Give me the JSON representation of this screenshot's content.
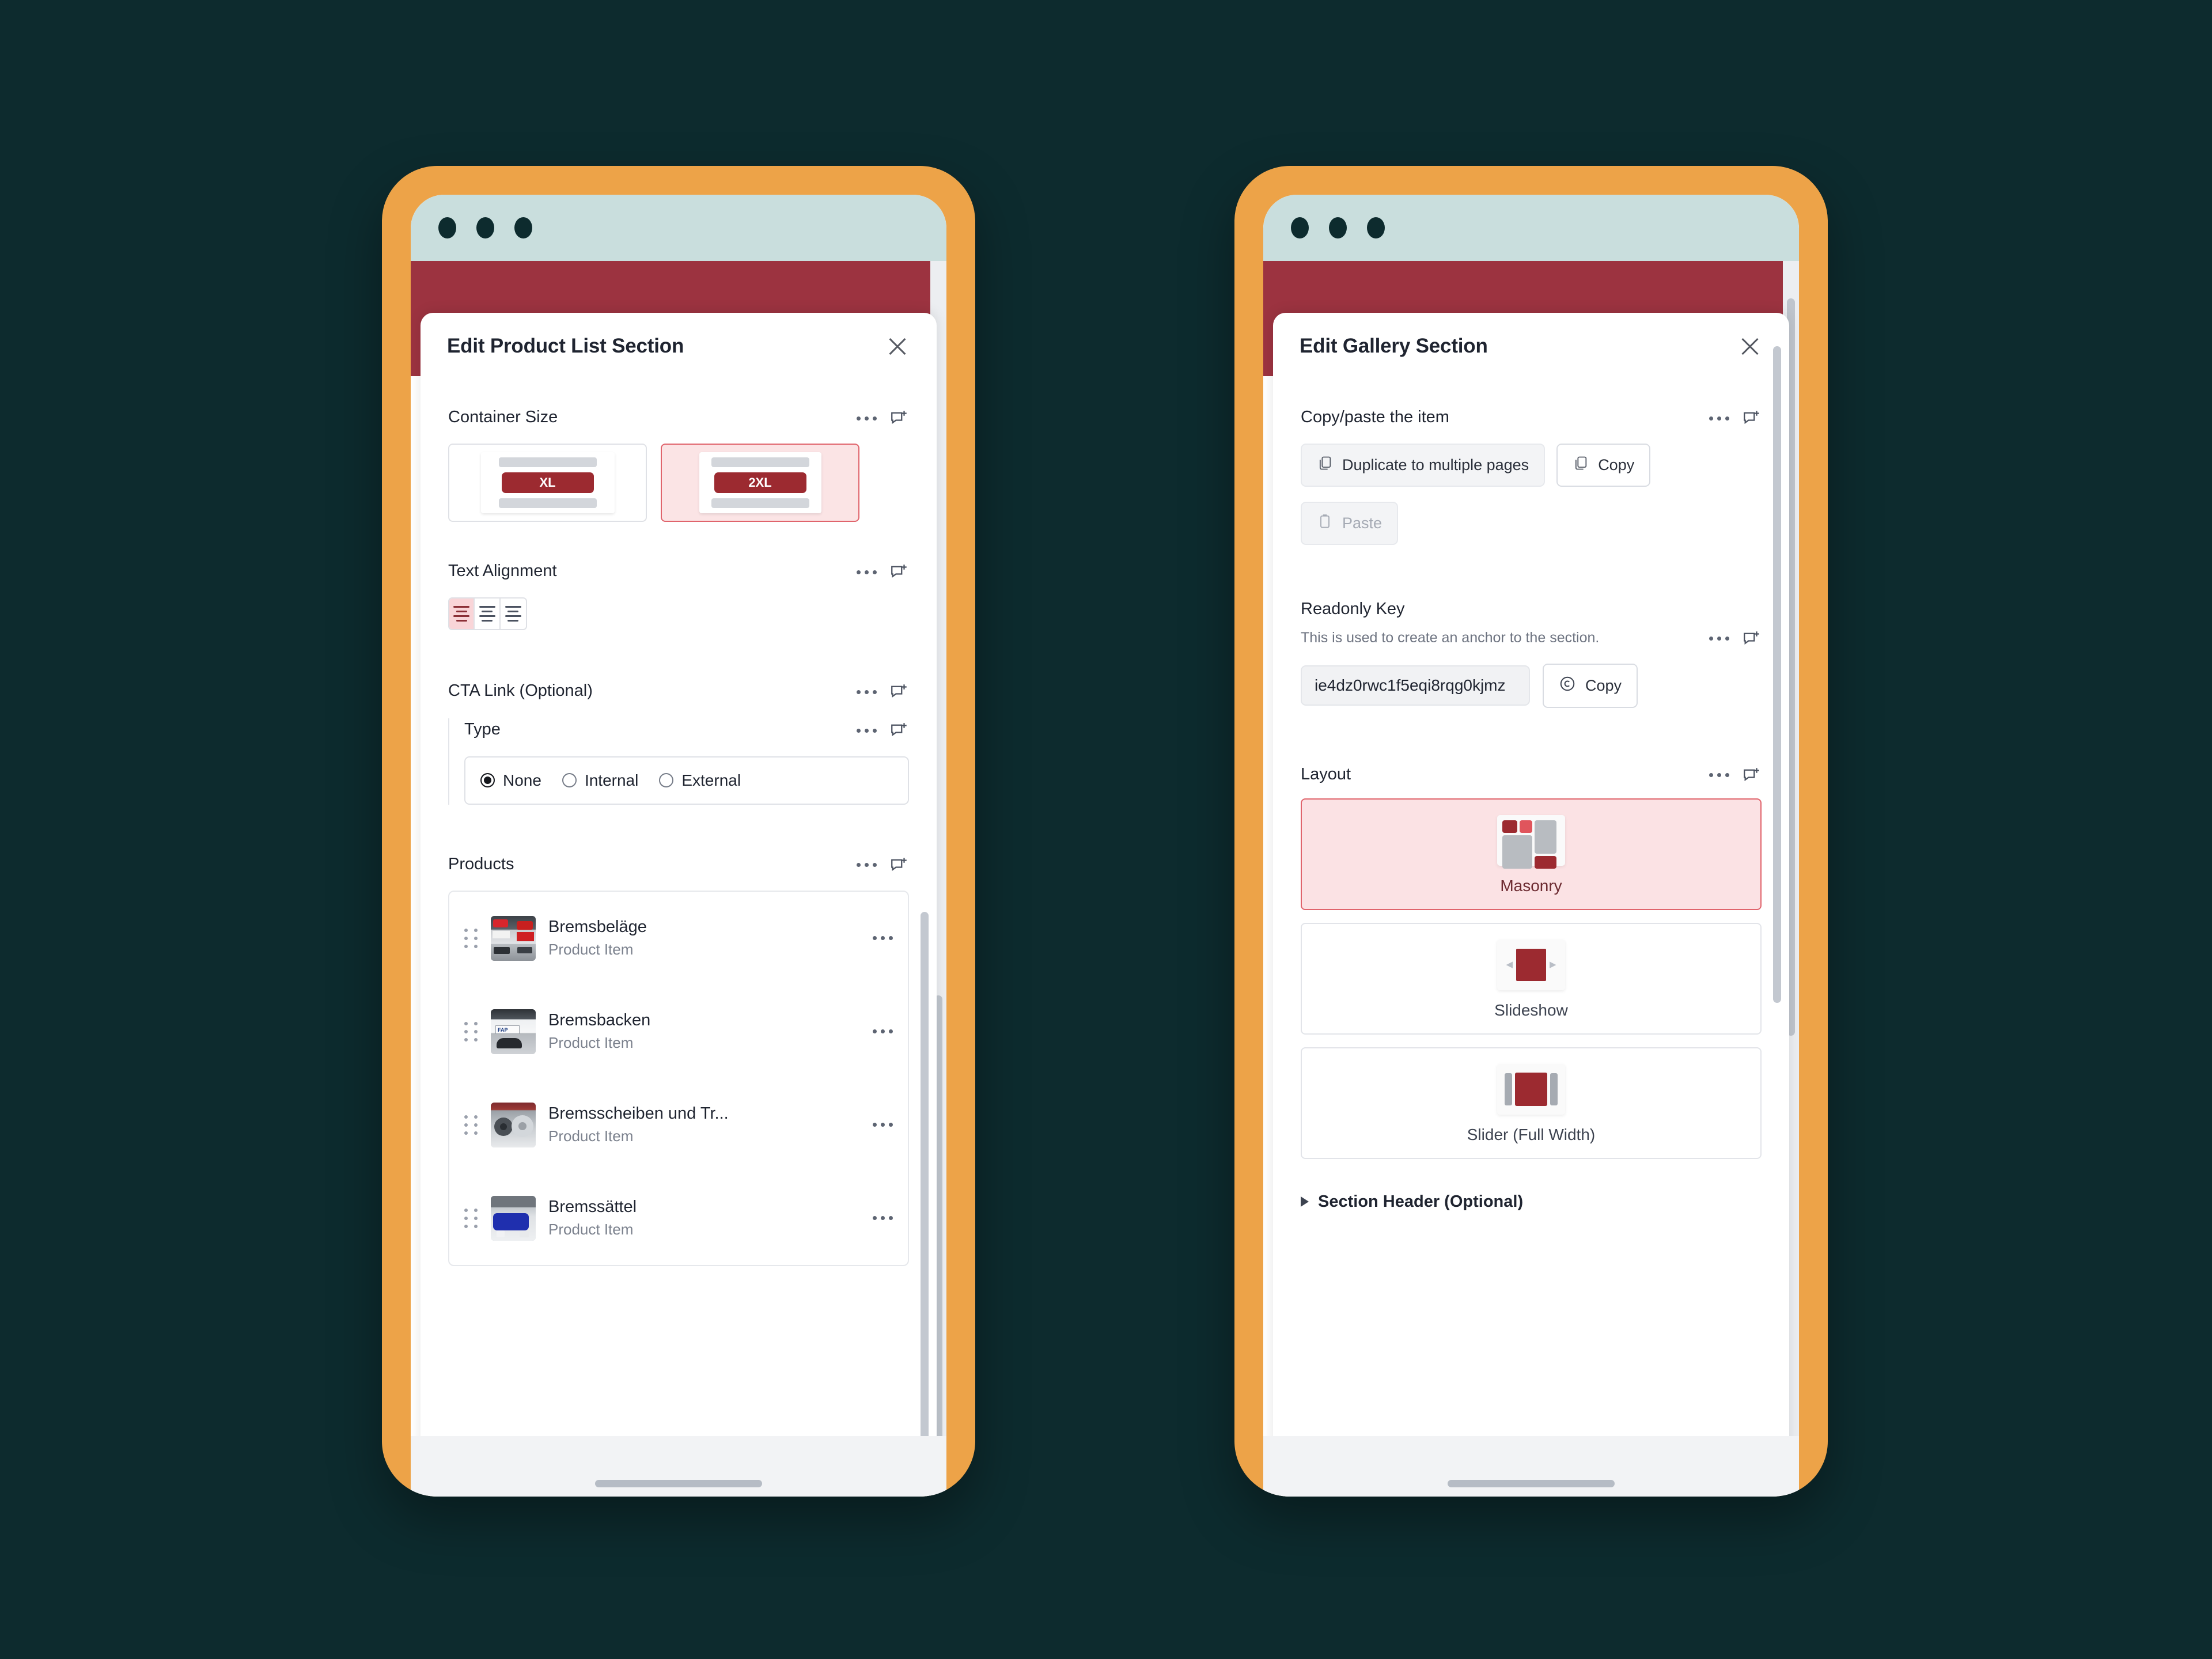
{
  "background_color": "#0d2b2e",
  "frame_color": "#eda348",
  "chrome_color": "#c9dedd",
  "site_band_color": "#9c3340",
  "accent_red": "#9c2a30",
  "selected_border": "#e0646c",
  "selected_fill": "#fbe2e4",
  "phones": [
    {
      "id": "product-list",
      "modal": {
        "title": "Edit Product List Section",
        "close_label": "Close",
        "fields": [
          {
            "label": "Container Size",
            "options": [
              {
                "label": "XL",
                "selected": false
              },
              {
                "label": "2XL",
                "selected": true
              }
            ]
          },
          {
            "label": "Text Alignment",
            "options": [
              {
                "label": "Align left",
                "selected": true
              },
              {
                "label": "Align center",
                "selected": false
              },
              {
                "label": "Align right",
                "selected": false
              }
            ]
          },
          {
            "label": "CTA Link (Optional)",
            "nested_label": "Type",
            "radios": [
              {
                "label": "None",
                "selected": true
              },
              {
                "label": "Internal",
                "selected": false
              },
              {
                "label": "External",
                "selected": false
              }
            ]
          },
          {
            "label": "Products",
            "items": [
              {
                "title": "Bremsbeläge",
                "subtitle": "Product Item"
              },
              {
                "title": "Bremsbacken",
                "subtitle": "Product Item"
              },
              {
                "title": "Bremsscheiben und Tr...",
                "subtitle": "Product Item"
              },
              {
                "title": "Bremssättel",
                "subtitle": "Product Item"
              }
            ]
          }
        ]
      }
    },
    {
      "id": "gallery",
      "modal": {
        "title": "Edit Gallery Section",
        "close_label": "Close",
        "copy_paste": {
          "label": "Copy/paste the item",
          "duplicate_label": "Duplicate to multiple pages",
          "copy_label": "Copy",
          "paste_label": "Paste",
          "paste_disabled": true
        },
        "readonly_key": {
          "label": "Readonly Key",
          "description": "This is used to create an anchor to the section.",
          "value": "ie4dz0rwc1f5eqi8rqg0kjmz",
          "copy_label": "Copy"
        },
        "layout": {
          "label": "Layout",
          "options": [
            {
              "label": "Masonry",
              "selected": true
            },
            {
              "label": "Slideshow",
              "selected": false
            },
            {
              "label": "Slider (Full Width)",
              "selected": false
            }
          ]
        },
        "section_header": {
          "label": "Section Header (Optional)",
          "expanded": false
        }
      }
    }
  ],
  "icons": {
    "traffic_dots": [
      "window-dot",
      "window-dot",
      "window-dot"
    ],
    "more_options": "ellipsis-icon",
    "add_comment": "add-comment-icon",
    "duplicate": "duplicate-icon",
    "copy": "copy-icon",
    "paste": "paste-icon",
    "copy_key": "copy-circle-icon",
    "drag_handle": "drag-handle-icon",
    "close": "close-icon",
    "disclosure": "triangle-right-icon"
  }
}
